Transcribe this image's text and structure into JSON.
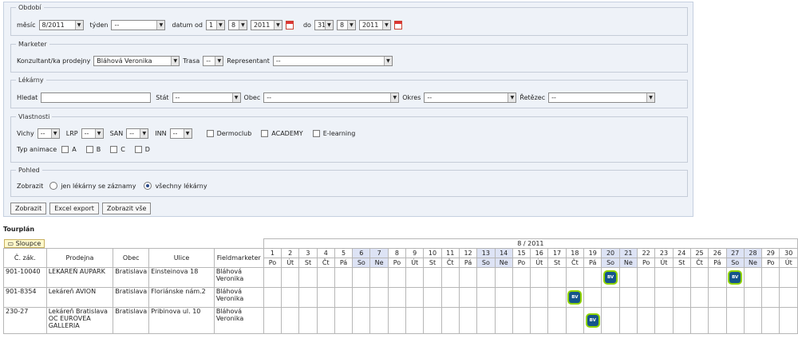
{
  "obdobi": {
    "legend": "Období",
    "mesic_label": "měsíc",
    "mesic_value": "8/2011",
    "tyden_label": "týden",
    "tyden_value": "--",
    "datum_od_label": "datum od",
    "od_day": "1",
    "od_month": "8",
    "od_year": "2011",
    "do_label": "do",
    "do_day": "31",
    "do_month": "8",
    "do_year": "2011"
  },
  "marketer": {
    "legend": "Marketer",
    "konzultant_label": "Konzultant/ka prodejny",
    "konzultant_value": "Bláhová Veronika",
    "trasa_label": "Trasa",
    "trasa_value": "--",
    "representant_label": "Representant",
    "representant_value": "--"
  },
  "lekarny": {
    "legend": "Lékárny",
    "hledat_label": "Hledat",
    "hledat_value": "",
    "stat_label": "Stát",
    "stat_value": "--",
    "obec_label": "Obec",
    "obec_value": "--",
    "okres_label": "Okres",
    "okres_value": "--",
    "retezec_label": "Řetězec",
    "retezec_value": "--"
  },
  "vlastnosti": {
    "legend": "Vlastnosti",
    "vichy_label": "Vichy",
    "vichy_value": "--",
    "lrp_label": "LRP",
    "lrp_value": "--",
    "san_label": "SAN",
    "san_value": "--",
    "inn_label": "INN",
    "inn_value": "--",
    "dermoclub": "Dermoclub",
    "academy": "ACADEMY",
    "elearning": "E-learning",
    "typ_label": "Typ animace",
    "typ_a": "A",
    "typ_b": "B",
    "typ_c": "C",
    "typ_d": "D"
  },
  "pohled": {
    "legend": "Pohled",
    "zobrazit_label": "Zobrazit",
    "option1": "jen lékárny se záznamy",
    "option2": "všechny lékárny"
  },
  "buttons": {
    "zobrazit": "Zobrazit",
    "excel": "Excel export",
    "zobrazit_vse": "Zobrazit vše"
  },
  "tourplan": {
    "title": "Tourplán",
    "sloupce": "Sloupce",
    "month_header": "8 / 2011",
    "col_zak": "Č. zák.",
    "col_prodejna": "Prodejna",
    "col_obec": "Obec",
    "col_ulice": "Ulice",
    "col_fieldmarketer": "Fieldmarketer",
    "days": [
      "1",
      "2",
      "3",
      "4",
      "5",
      "6",
      "7",
      "8",
      "9",
      "10",
      "11",
      "12",
      "13",
      "14",
      "15",
      "16",
      "17",
      "18",
      "19",
      "20",
      "21",
      "22",
      "23",
      "24",
      "25",
      "26",
      "27",
      "28",
      "29",
      "30"
    ],
    "daynames": [
      "Po",
      "Út",
      "St",
      "Čt",
      "Pá",
      "So",
      "Ne",
      "Po",
      "Út",
      "St",
      "Čt",
      "Pá",
      "So",
      "Ne",
      "Po",
      "Út",
      "St",
      "Čt",
      "Pá",
      "So",
      "Ne",
      "Po",
      "Út",
      "St",
      "Čt",
      "Pá",
      "So",
      "Ne",
      "Po",
      "Út"
    ],
    "badge": "BV",
    "rows": [
      {
        "zak": "901-10040",
        "prodejna": "LEKÁREŇ AUPARK",
        "obec": "Bratislava",
        "ulice": "Einsteinova 18",
        "fm": "Bláhová Veronika",
        "visits": [
          20,
          27
        ]
      },
      {
        "zak": "901-8354",
        "prodejna": "Lekáreň AVION",
        "obec": "Bratislava",
        "ulice": "Floriánske nám.2",
        "fm": "Bláhová Veronika",
        "visits": [
          18
        ]
      },
      {
        "zak": "230-27",
        "prodejna": "Lekáreň Bratislava OC EUROVEA GALLERIA",
        "obec": "Bratislava",
        "ulice": "Pribinova ul. 10",
        "fm": "Bláhová Veronika",
        "visits": [
          19
        ]
      }
    ]
  }
}
